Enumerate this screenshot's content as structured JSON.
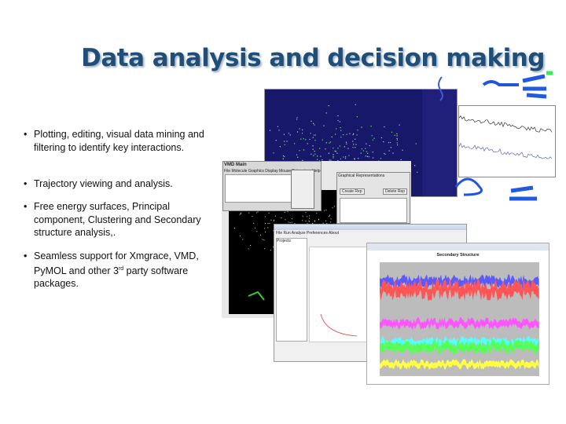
{
  "slide": {
    "title": "Data analysis and decision making",
    "bullets": [
      {
        "text": "Plotting, editing, visual data mining and filtering to identify key interactions."
      },
      {
        "text": "Trajectory viewing and analysis."
      },
      {
        "text": "Free energy surfaces, Principal component, Clustering and Secondary structure analysis,."
      },
      {
        "text_pre": "Seamless support for Xmgrace, VMD, PyMOL and other 3",
        "sup": "rd",
        "text_post": " party software packages."
      }
    ],
    "bullet_glyph": "•"
  },
  "screens": {
    "vmd_main": {
      "title": "VMD Main",
      "menu": "File  Molecule  Graphics  Display  Mouse  Extensions  Help"
    },
    "graphical_reps": {
      "title": "Graphical Representations",
      "create": "Create Rep",
      "delete": "Delete Rep"
    },
    "gromacs": {
      "menu": "File  Run  Analyze  Preferences  About",
      "tree_root": "Projects"
    },
    "secondary_structure": {
      "title": "Secondary Structure"
    },
    "colors": {
      "scatter_bg": "#17186a",
      "coil": "#ff5555",
      "helix": "#5a5aff",
      "turn": "#ff55ff",
      "sheet": "#55ff55",
      "bridge": "#55ffff",
      "bend": "#ffff44",
      "title": "#1f4e79"
    }
  }
}
